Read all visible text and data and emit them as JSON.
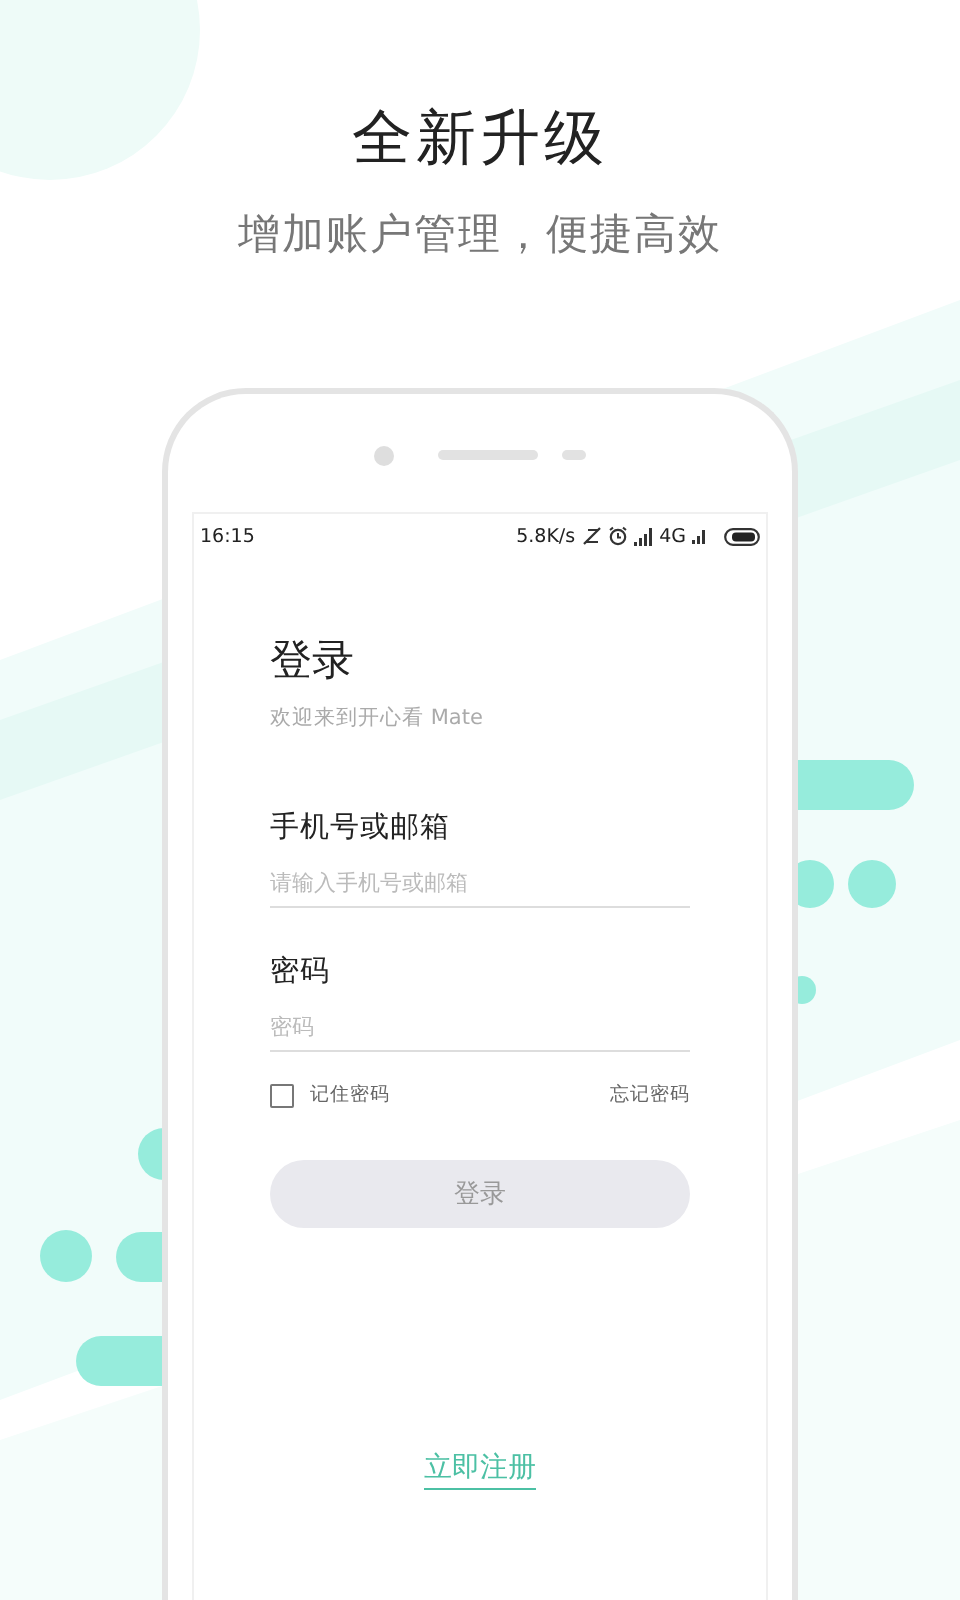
{
  "header": {
    "title": "全新升级",
    "subtitle": "增加账户管理，便捷高效"
  },
  "status_bar": {
    "time": "16:15",
    "net_speed": "5.8K/s",
    "network": "4G"
  },
  "login": {
    "title": "登录",
    "welcome": "欢迎来到开心看 Mate",
    "fields": [
      {
        "label": "手机号或邮箱",
        "placeholder": "请输入手机号或邮箱"
      },
      {
        "label": "密码",
        "placeholder": "密码"
      }
    ],
    "remember": {
      "label": "记住密码",
      "checked": false
    },
    "forgot": "忘记密码",
    "submit": {
      "label": "登录",
      "disabled": true
    },
    "register": "立即注册"
  }
}
